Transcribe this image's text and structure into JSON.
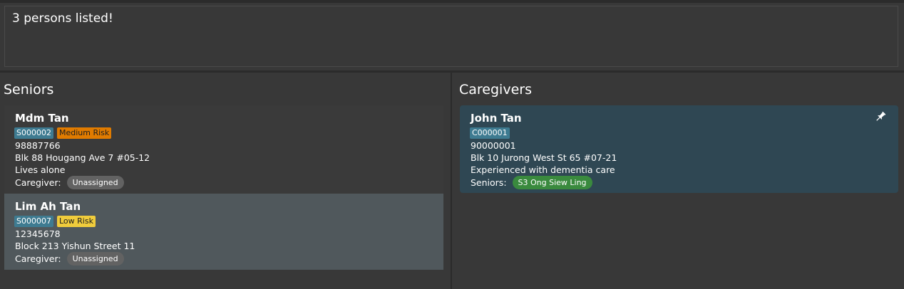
{
  "result": {
    "message": "3 persons listed!"
  },
  "seniors_panel": {
    "title": "Seniors",
    "cards": [
      {
        "name": "Mdm Tan",
        "id_tag": "S000002",
        "risk_tag": "Medium Risk",
        "phone": "98887766",
        "address": "Blk 88 Hougang Ave 7 #05-12",
        "note": "Lives alone",
        "caregiver_label": "Caregiver:",
        "caregiver_value": "Unassigned"
      },
      {
        "name": "Lim Ah Tan",
        "id_tag": "S000007",
        "risk_tag": "Low Risk",
        "phone": "12345678",
        "address": "Block 213 Yishun Street 11",
        "caregiver_label": "Caregiver:",
        "caregiver_value": "Unassigned"
      }
    ]
  },
  "caregivers_panel": {
    "title": "Caregivers",
    "cards": [
      {
        "name": "John Tan",
        "id_tag": "C000001",
        "phone": "90000001",
        "address": "Blk 10 Jurong West St 65 #07-21",
        "note": "Experienced with dementia care",
        "seniors_label": "Seniors:",
        "seniors_value": "S3 Ong Siew Ling",
        "pinned": true
      }
    ]
  },
  "colors": {
    "background": "#383838",
    "card_default": "#3a3a3a",
    "card_selected": "#50585c",
    "card_caregiver": "#2f4753",
    "medium_risk": "#e07b00",
    "low_risk": "#f0cc3c",
    "id_tag": "#3e7b91",
    "assigned_pill": "#3a8a3e",
    "unassigned_pill": "#626262"
  },
  "icons": {
    "pin": "pushpin-icon"
  }
}
